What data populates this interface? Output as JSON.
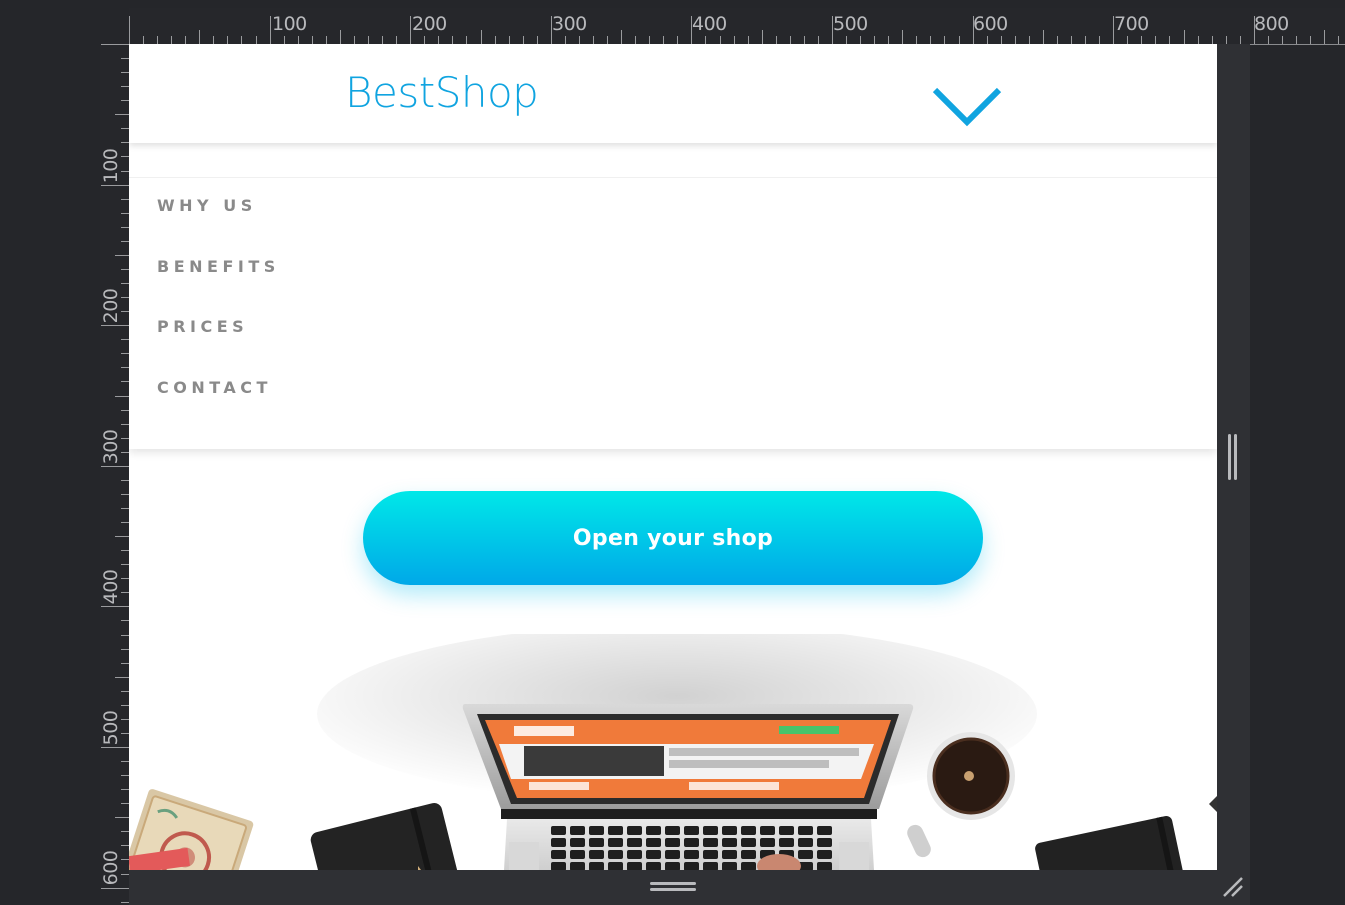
{
  "ruler": {
    "x_labels": [
      "100",
      "200",
      "300",
      "400",
      "500",
      "600",
      "700",
      "800"
    ],
    "y_labels": [
      "100",
      "200",
      "300",
      "400",
      "500",
      "600"
    ]
  },
  "site": {
    "logo": "BestShop",
    "brand_color": "#10a4e0",
    "menu_icon": "chevron-down-icon"
  },
  "nav": {
    "items": [
      {
        "label": "WHY US"
      },
      {
        "label": "BENEFITS"
      },
      {
        "label": "PRICES"
      },
      {
        "label": "CONTACT"
      }
    ]
  },
  "cta": {
    "label": "Open your shop",
    "gradient_top": "#00e8e8",
    "gradient_bottom": "#00a8e8"
  },
  "hero": {
    "image_icon": "desk-laptop-illustration"
  },
  "devtools": {
    "vertical_resize_icon": "vertical-resize-handle-icon",
    "horizontal_resize_icon": "horizontal-resize-handle-icon",
    "corner_icon": "resize-corner-icon"
  }
}
